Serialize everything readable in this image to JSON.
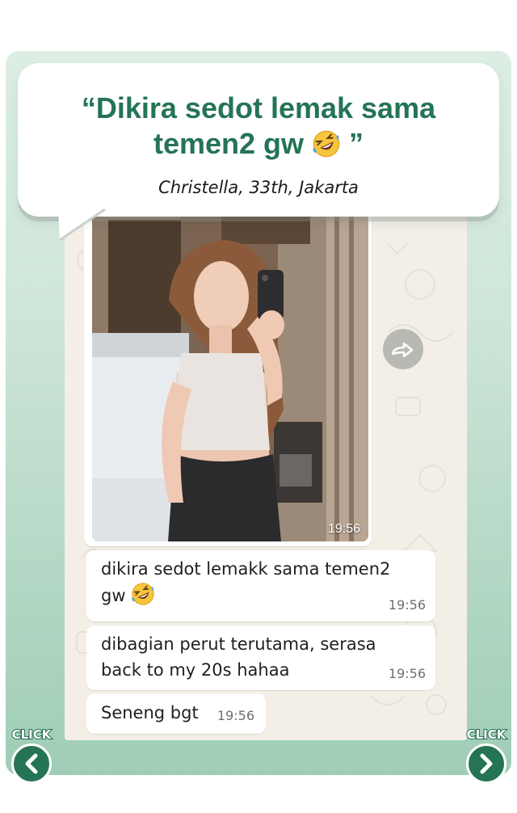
{
  "testimonial": {
    "headline_line1": "“Dikira sedot lemak sama",
    "headline_line2": "temen2 gw",
    "headline_emoji": "rolling-on-floor-laughing-emoji",
    "headline_close_quote": "”",
    "author": "Christella, 33th, Jakarta"
  },
  "chat": {
    "photo_time": "19:56",
    "forward_icon": "forward-icon",
    "messages": [
      {
        "line1": "dikira sedot lemakk sama temen2",
        "line2": "gw",
        "emoji": "rolling-on-floor-laughing-emoji",
        "time": "19:56"
      },
      {
        "line1": "dibagian perut terutama, serasa",
        "line2": "back to my 20s hahaa",
        "time": "19:56"
      },
      {
        "line1": "Seneng bgt",
        "time": "19:56"
      }
    ]
  },
  "nav": {
    "prev_label": "CLICK",
    "next_label": "CLICK",
    "prev_icon": "chevron-left-icon",
    "next_icon": "chevron-right-icon"
  },
  "colors": {
    "brand_green": "#247455",
    "card_gradient_top": "#dceee4",
    "card_gradient_bottom": "#9fcdb5",
    "chat_background": "#f3efe6"
  }
}
